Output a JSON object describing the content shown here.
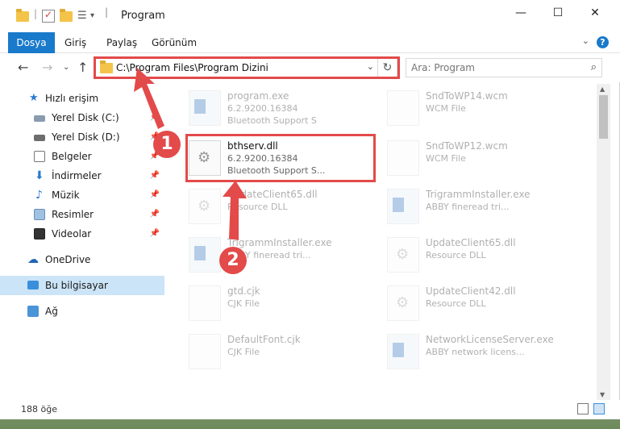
{
  "window": {
    "title": "Program"
  },
  "ribbon": {
    "tabs": [
      "Dosya",
      "Giriş",
      "Paylaş",
      "Görünüm"
    ],
    "help": "?"
  },
  "address": {
    "path": "C:\\Program Files\\Program Dizini"
  },
  "search": {
    "placeholder": "Ara: Program"
  },
  "sidebar": {
    "quick_access": "Hızlı erişim",
    "items": [
      {
        "label": "Yerel Disk (C:)",
        "pinned": true
      },
      {
        "label": "Yerel Disk (D:)",
        "pinned": true
      },
      {
        "label": "Belgeler",
        "pinned": true
      },
      {
        "label": "İndirmeler",
        "pinned": true
      },
      {
        "label": "Müzik",
        "pinned": true
      },
      {
        "label": "Resimler",
        "pinned": true
      },
      {
        "label": "Videolar",
        "pinned": true
      }
    ],
    "onedrive": "OneDrive",
    "this_pc": "Bu bilgisayar",
    "network": "Ağ"
  },
  "files": {
    "left": [
      {
        "name": "program.exe",
        "meta1": "6.2.9200.16384",
        "meta2": "Bluetooth Support S"
      },
      {
        "name": "bthserv.dll",
        "meta1": "6.2.9200.16384",
        "meta2": "Bluetooth Support S..."
      },
      {
        "name": "UpdateClient65.dll",
        "meta1": "Resource DLL",
        "meta2": ""
      },
      {
        "name": "TrigrammInstaller.exe",
        "meta1": "ABBY fineread tri...",
        "meta2": ""
      },
      {
        "name": "gtd.cjk",
        "meta1": "CJK File",
        "meta2": ""
      },
      {
        "name": "DefaultFont.cjk",
        "meta1": "CJK File",
        "meta2": ""
      }
    ],
    "right": [
      {
        "name": "SndToWP14.wcm",
        "meta1": "WCM File"
      },
      {
        "name": "SndToWP12.wcm",
        "meta1": "WCM File"
      },
      {
        "name": "TrigrammInstaller.exe",
        "meta1": "ABBY fineread tri..."
      },
      {
        "name": "UpdateClient65.dll",
        "meta1": "Resource DLL"
      },
      {
        "name": "UpdateClient42.dll",
        "meta1": "Resource DLL"
      },
      {
        "name": "NetworkLicenseServer.exe",
        "meta1": "ABBY network licens..."
      }
    ]
  },
  "status": {
    "count": "188 öğe"
  },
  "annotations": {
    "badge1": "1",
    "badge2": "2",
    "color": "#e34a4a"
  }
}
